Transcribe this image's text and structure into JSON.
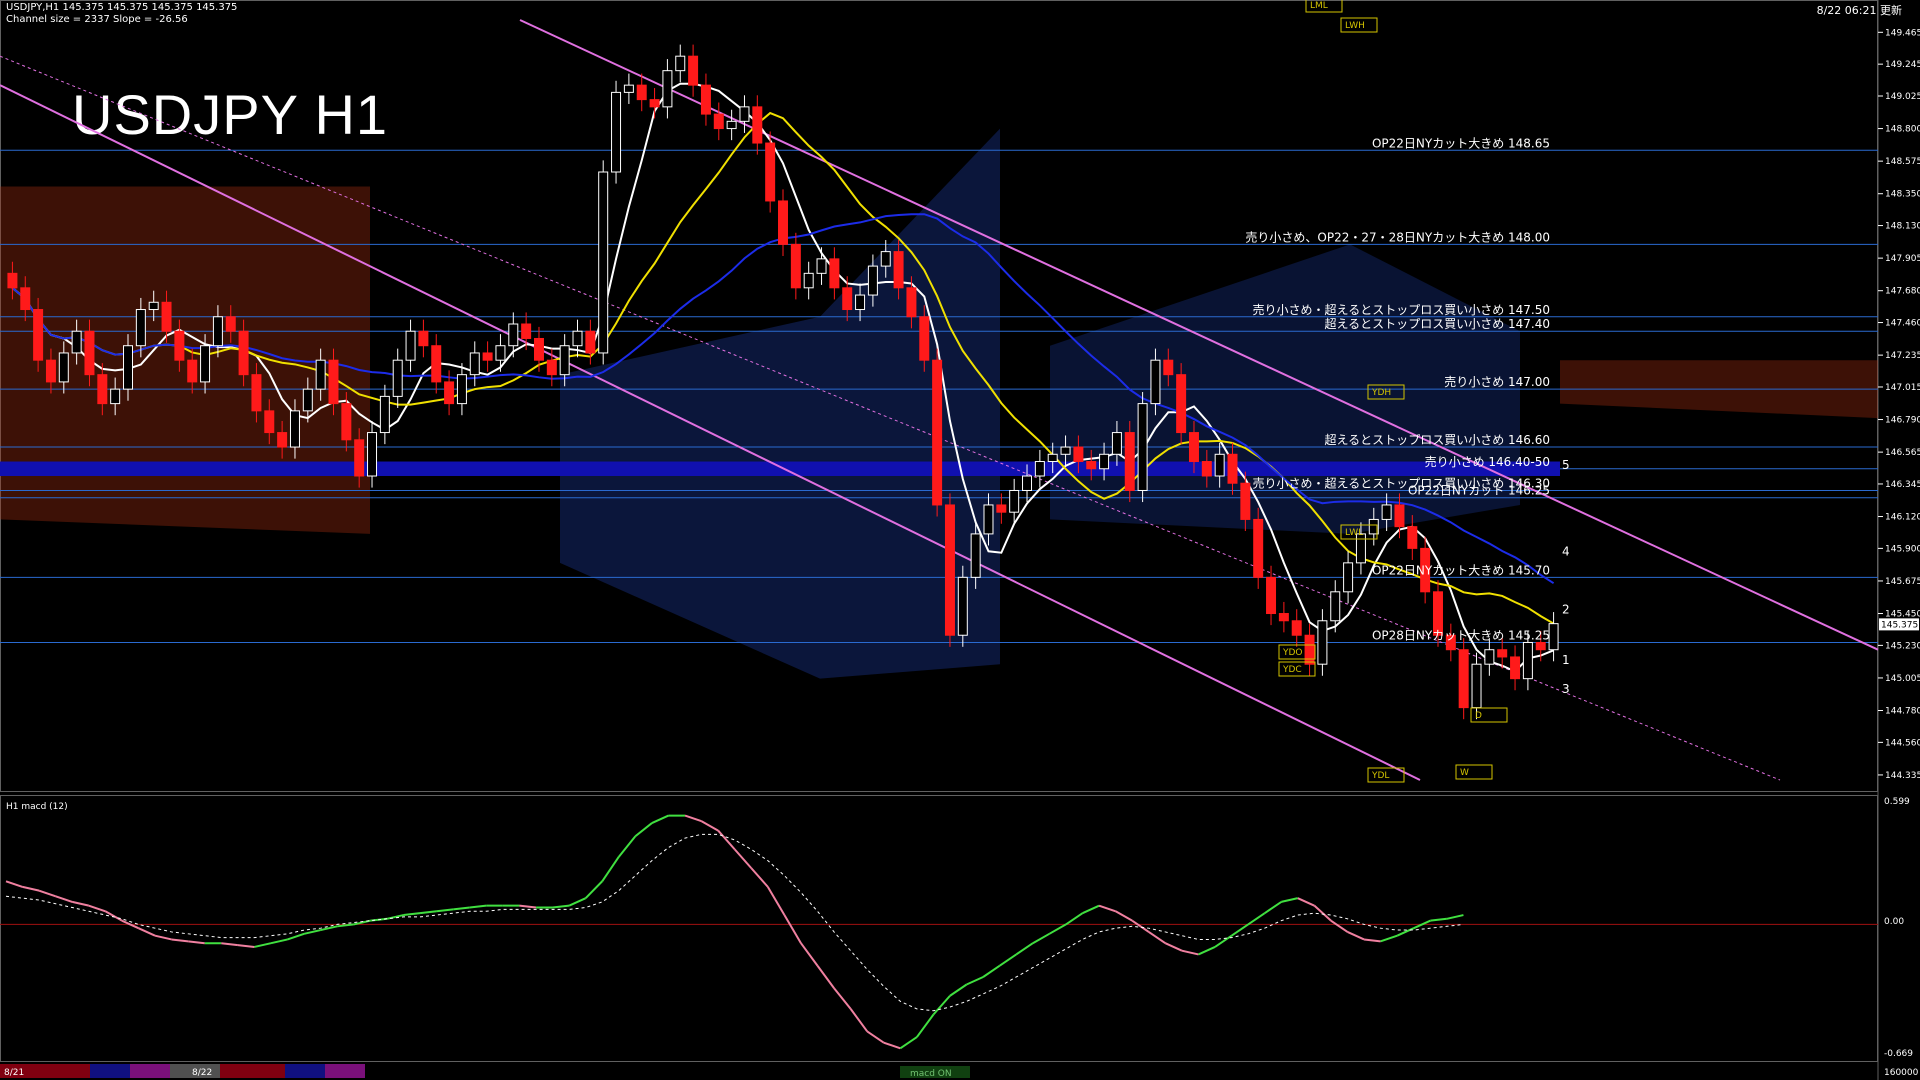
{
  "header": {
    "symbol_line": "USDJPY,H1  145.375 145.375 145.375 145.375",
    "channel_line": "Channel size = 2337 Slope = -26.56",
    "title": "USDJPY H1",
    "clock": "8/22 06:21 更新",
    "macd_label": "H1  macd (12)"
  },
  "colors": {
    "background": "#000000",
    "grid": "#1e3c78",
    "bull_candle": "#ffffff",
    "bear_candle": "#ff1a1a",
    "cloud_bull": "#1f3fa8",
    "cloud_bear": "#b03010",
    "channel": "#e070e0",
    "ma_fast": "#ffffff",
    "ma_mid": "#f0e000",
    "ma_slow": "#1c2ce8",
    "macd_up": "#40e040",
    "macd_down": "#f080a0"
  },
  "price_axis": {
    "ticks": [
      "149.465",
      "149.245",
      "149.025",
      "148.800",
      "148.575",
      "148.350",
      "148.130",
      "147.905",
      "147.680",
      "147.460",
      "147.235",
      "147.015",
      "146.790",
      "146.565",
      "146.345",
      "146.120",
      "145.900",
      "145.675",
      "145.450",
      "145.230",
      "145.005",
      "144.780",
      "144.560",
      "144.335"
    ],
    "current": "145.375"
  },
  "macd_axis": {
    "top": "0.599",
    "zero": "0.00",
    "bottom": "-0.669"
  },
  "bottom_axis": {
    "left_date": "8/21",
    "mid_date": "8/22",
    "right_label": "160000",
    "center_tag": "macd ON"
  },
  "annotations": [
    {
      "text": "OP22日NYカット大きめ 148.65",
      "y": 148.65
    },
    {
      "text": "売り小さめ、OP22・27・28日NYカット大きめ 148.00",
      "y": 148.0
    },
    {
      "text": "売り小さめ・超えるとストップロス買い小さめ 147.50",
      "y": 147.5
    },
    {
      "text": "超えるとストップロス買い小さめ 147.40",
      "y": 147.4
    },
    {
      "text": "売り小さめ 147.00",
      "y": 147.0
    },
    {
      "text": "超えるとストップロス買い小さめ 146.60",
      "y": 146.6
    },
    {
      "text": "売り小さめ 146.40-50",
      "y": 146.45
    },
    {
      "text": "売り小さめ・超えるとストップロス買い小さめ 146.30",
      "y": 146.3
    },
    {
      "text": "OP22日NYカット 146.25",
      "y": 146.25
    },
    {
      "text": "OP22日NYカット大きめ 145.70",
      "y": 145.7
    },
    {
      "text": "OP28日NYカット大きめ 145.25",
      "y": 145.25
    }
  ],
  "level_tags": [
    "LML",
    "LWH",
    "YDH",
    "YDL",
    "LWL",
    "YDO",
    "YDC",
    "D",
    "W"
  ],
  "projection_labels": [
    "1",
    "2",
    "3",
    "4",
    "5"
  ],
  "chart_data": {
    "type": "candlestick",
    "ylim": [
      144.3,
      149.55
    ],
    "macd_ylim": [
      -0.669,
      0.599
    ],
    "closes": [
      147.7,
      147.55,
      147.2,
      147.05,
      147.25,
      147.4,
      147.1,
      146.9,
      147.0,
      147.3,
      147.55,
      147.6,
      147.4,
      147.2,
      147.05,
      147.3,
      147.5,
      147.4,
      147.1,
      146.85,
      146.7,
      146.6,
      146.85,
      147.0,
      147.2,
      146.9,
      146.65,
      146.4,
      146.7,
      146.95,
      147.2,
      147.4,
      147.3,
      147.05,
      146.9,
      147.1,
      147.25,
      147.2,
      147.3,
      147.45,
      147.35,
      147.2,
      147.1,
      147.3,
      147.4,
      147.25,
      148.5,
      149.05,
      149.1,
      149.0,
      148.95,
      149.2,
      149.3,
      149.1,
      148.9,
      148.8,
      148.85,
      148.95,
      148.7,
      148.3,
      148.0,
      147.7,
      147.8,
      147.9,
      147.7,
      147.55,
      147.65,
      147.85,
      147.95,
      147.7,
      147.5,
      147.2,
      146.2,
      145.3,
      145.7,
      146.0,
      146.2,
      146.15,
      146.3,
      146.4,
      146.5,
      146.55,
      146.6,
      146.5,
      146.45,
      146.55,
      146.7,
      146.3,
      146.9,
      147.2,
      147.1,
      146.7,
      146.5,
      146.4,
      146.55,
      146.35,
      146.1,
      145.7,
      145.45,
      145.4,
      145.3,
      145.1,
      145.4,
      145.6,
      145.8,
      146.0,
      146.1,
      146.2,
      146.05,
      145.9,
      145.6,
      145.3,
      145.2,
      144.8,
      145.1,
      145.2,
      145.15,
      145.0,
      145.25,
      145.2,
      145.38
    ],
    "macd": [
      0.23,
      0.2,
      0.18,
      0.15,
      0.12,
      0.1,
      0.07,
      0.02,
      -0.02,
      -0.06,
      -0.08,
      -0.09,
      -0.1,
      -0.1,
      -0.11,
      -0.12,
      -0.1,
      -0.08,
      -0.05,
      -0.03,
      -0.01,
      0.0,
      0.02,
      0.03,
      0.05,
      0.06,
      0.07,
      0.08,
      0.09,
      0.1,
      0.1,
      0.1,
      0.09,
      0.09,
      0.1,
      0.14,
      0.23,
      0.36,
      0.47,
      0.54,
      0.58,
      0.58,
      0.55,
      0.5,
      0.4,
      0.3,
      0.2,
      0.05,
      -0.1,
      -0.22,
      -0.34,
      -0.45,
      -0.57,
      -0.63,
      -0.66,
      -0.6,
      -0.48,
      -0.38,
      -0.32,
      -0.28,
      -0.22,
      -0.16,
      -0.1,
      -0.05,
      0.0,
      0.06,
      0.1,
      0.07,
      0.02,
      -0.04,
      -0.1,
      -0.14,
      -0.16,
      -0.12,
      -0.06,
      0.0,
      0.06,
      0.12,
      0.14,
      0.1,
      0.02,
      -0.04,
      -0.08,
      -0.09,
      -0.06,
      -0.02,
      0.02,
      0.03,
      0.05
    ],
    "macd_signal": [
      0.15,
      0.14,
      0.13,
      0.11,
      0.09,
      0.07,
      0.05,
      0.03,
      0.0,
      -0.02,
      -0.04,
      -0.05,
      -0.06,
      -0.07,
      -0.07,
      -0.07,
      -0.06,
      -0.05,
      -0.03,
      -0.02,
      0.0,
      0.01,
      0.02,
      0.03,
      0.04,
      0.04,
      0.05,
      0.06,
      0.07,
      0.07,
      0.08,
      0.08,
      0.08,
      0.08,
      0.08,
      0.09,
      0.12,
      0.18,
      0.26,
      0.34,
      0.41,
      0.46,
      0.48,
      0.48,
      0.45,
      0.4,
      0.34,
      0.26,
      0.17,
      0.07,
      -0.04,
      -0.14,
      -0.24,
      -0.33,
      -0.41,
      -0.45,
      -0.46,
      -0.44,
      -0.41,
      -0.37,
      -0.33,
      -0.28,
      -0.23,
      -0.18,
      -0.13,
      -0.08,
      -0.04,
      -0.02,
      -0.01,
      -0.02,
      -0.04,
      -0.06,
      -0.08,
      -0.08,
      -0.07,
      -0.05,
      -0.02,
      0.02,
      0.05,
      0.06,
      0.05,
      0.03,
      0.0,
      -0.02,
      -0.03,
      -0.03,
      -0.02,
      -0.01,
      0.0
    ]
  }
}
